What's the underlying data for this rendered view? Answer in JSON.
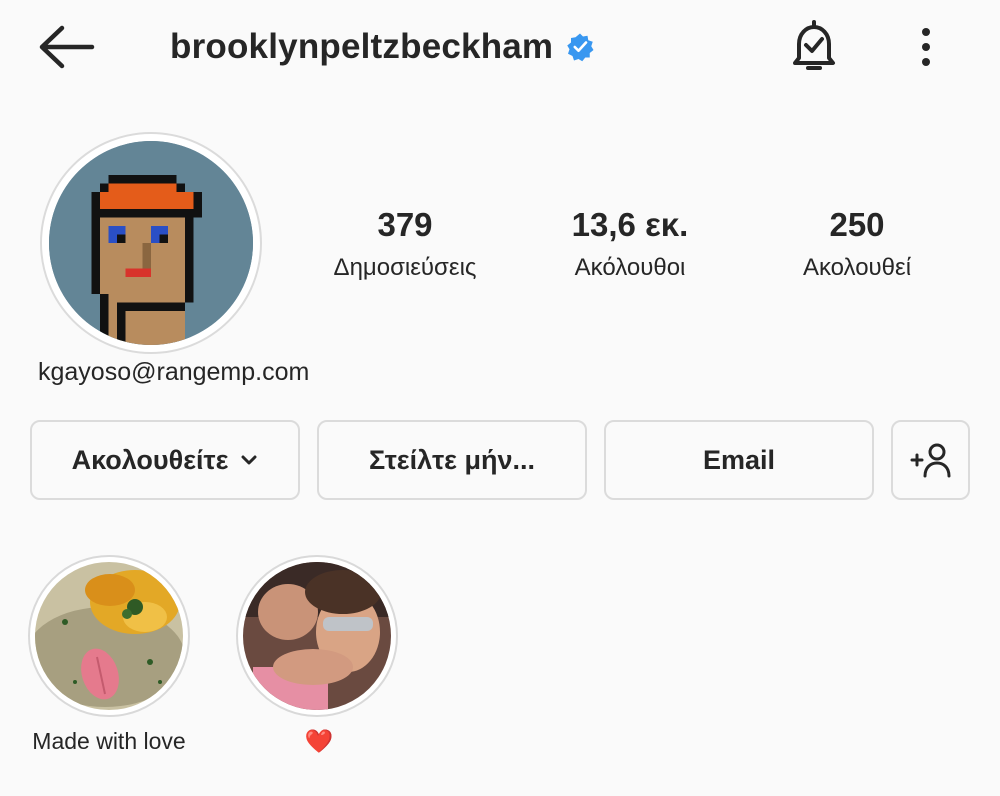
{
  "header": {
    "username": "brooklynpeltzbeckham",
    "back_icon": "arrow-left-icon",
    "verified_icon": "verified-badge-icon",
    "notifications_icon": "bell-check-icon",
    "more_icon": "more-vertical-icon"
  },
  "profile": {
    "avatar_icon": "pixel-art-avatar",
    "bio_email": "kgayoso@rangemp.com",
    "stats": [
      {
        "value": "379",
        "label": "Δημοσιεύσεις"
      },
      {
        "value": "13,6 εκ.",
        "label": "Ακόλουθοι"
      },
      {
        "value": "250",
        "label": "Ακολουθεί"
      }
    ]
  },
  "actions": {
    "following_label": "Ακολουθείτε",
    "message_label": "Στείλτε μήν...",
    "email_label": "Email",
    "add_user_icon": "add-person-icon"
  },
  "highlights": [
    {
      "label": "Made with love"
    },
    {
      "label": "❤️"
    }
  ],
  "colors": {
    "verified": "#3897f0",
    "avatar_bg": "#638596",
    "heart": "#e0245e",
    "border": "#dbdbdb"
  }
}
